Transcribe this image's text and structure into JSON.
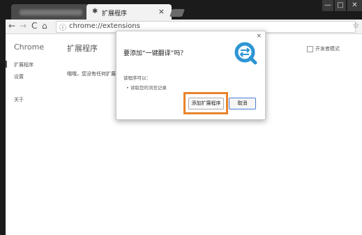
{
  "browser": {
    "active_tab_title": "扩展程序",
    "tab_close": "×",
    "back_icon": "←",
    "forward_icon": "→",
    "reload_icon": "C",
    "home_icon": "⌂",
    "info_icon": "ⓘ",
    "url": "chrome://extensions",
    "star_icon": "☆",
    "window_controls": [
      "—",
      "□",
      "✕"
    ]
  },
  "page": {
    "brand": "Chrome",
    "sidebar": [
      {
        "label": "扩展程序"
      },
      {
        "label": "设置"
      },
      {
        "label": "关于"
      }
    ],
    "title": "扩展程序",
    "empty_text": "哦哦，您没有任何扩展",
    "dev_mode_label": "开发者模式"
  },
  "dialog": {
    "close": "×",
    "title": "要添加“一键翻译”吗？",
    "subtitle": "该程序可以：",
    "permissions": [
      "•  读取您的浏览记录"
    ],
    "add_button": "添加扩展程序",
    "cancel_button": "取消",
    "logo_color": "#2d95d3",
    "highlight_color": "#e8832c"
  }
}
